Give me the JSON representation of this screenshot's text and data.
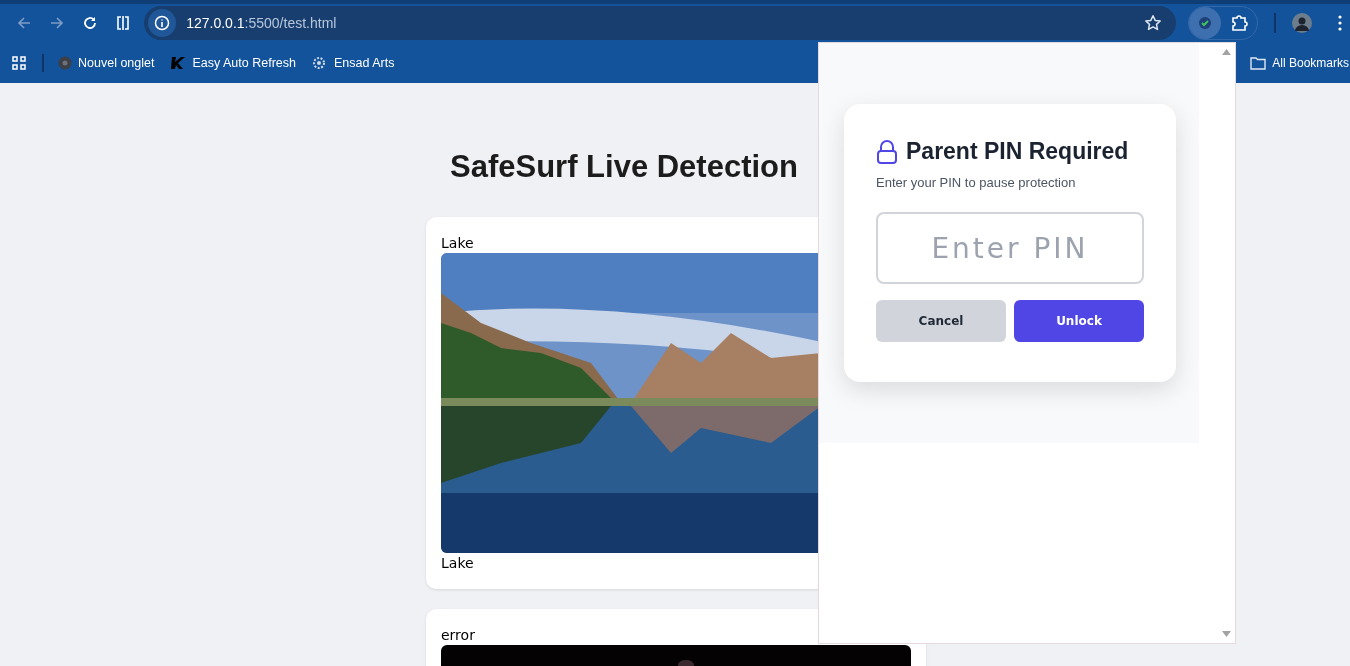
{
  "browser": {
    "nav_buttons": [
      {
        "kind": "back",
        "disabled": true
      },
      {
        "kind": "forward",
        "disabled": true
      },
      {
        "kind": "reload",
        "disabled": false
      }
    ],
    "address": {
      "host": "127.0.0.1",
      "path": ":5500/test.html"
    },
    "bookmarks": [
      {
        "label": "Nouvel onglet",
        "kind": "chrome"
      },
      {
        "label": "Easy Auto Refresh",
        "kind": "k"
      },
      {
        "label": "Ensad Arts",
        "kind": "gear"
      }
    ],
    "all_bookmarks": "All Bookmarks"
  },
  "page": {
    "title": "SafeSurf Live Detection",
    "cards": [
      {
        "label": "Lake",
        "kind": "lake",
        "caption": "Lake"
      },
      {
        "label": "error",
        "kind": "dark"
      }
    ]
  },
  "popup": {
    "title": "Parent PIN Required",
    "subtitle": "Enter your PIN to pause protection",
    "pin_placeholder": "Enter PIN",
    "buttons": [
      {
        "label": "Cancel",
        "kind": "secondary"
      },
      {
        "label": "Unlock",
        "kind": "primary"
      }
    ]
  }
}
